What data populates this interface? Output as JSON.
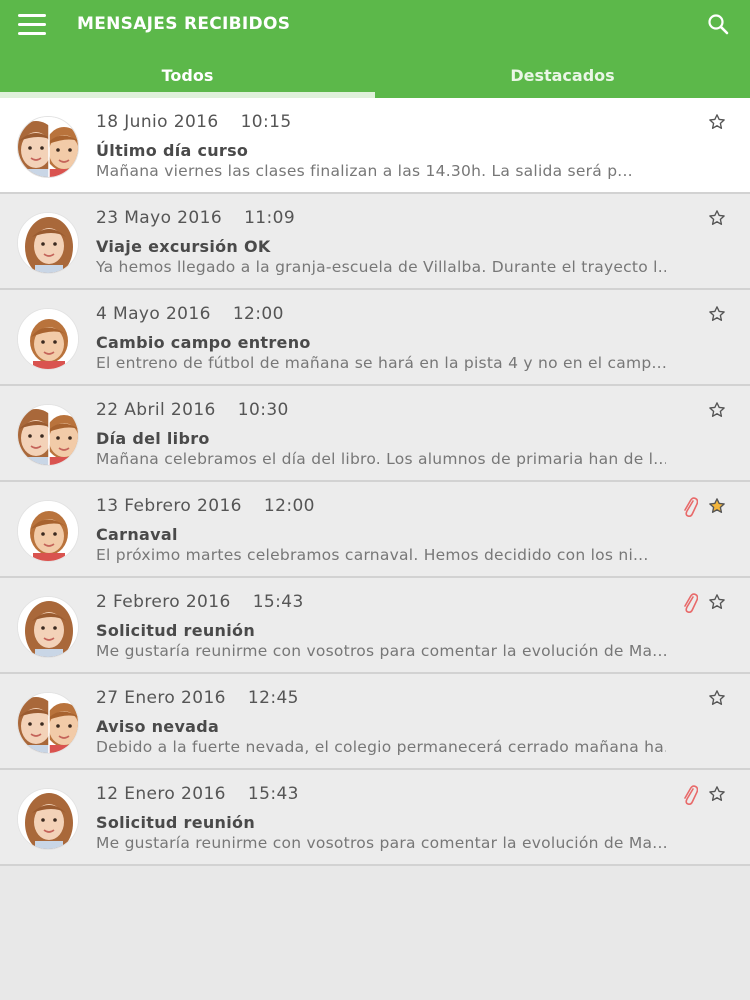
{
  "header": {
    "title": "MENSAJES RECIBIDOS",
    "menu_icon": "hamburger-menu-icon",
    "search_icon": "search-icon"
  },
  "tabs": [
    {
      "label": "Todos",
      "active": true
    },
    {
      "label": "Destacados",
      "active": false
    }
  ],
  "colors": {
    "primary": "#5cb84a",
    "star_active": "#f2b53c",
    "clip": "#e86a6a"
  },
  "messages": [
    {
      "date": "18 Junio 2016",
      "time": "10:15",
      "subject": "Último día curso",
      "preview": "Mañana viernes las clases finalizan a las 14.30h. La salida será p...",
      "avatar": "two-children",
      "attachment": false,
      "starred": false
    },
    {
      "date": "23 Mayo 2016",
      "time": "11:09",
      "subject": "Viaje excursión OK",
      "preview": "Ya hemos llegado a la granja-escuela de Villalba. Durante el trayecto l...",
      "avatar": "girl",
      "attachment": false,
      "starred": false
    },
    {
      "date": "4 Mayo 2016",
      "time": "12:00",
      "subject": "Cambio campo entreno",
      "preview": "El entreno de fútbol de mañana se hará en la pista 4 y no en el camp...",
      "avatar": "boy",
      "attachment": false,
      "starred": false
    },
    {
      "date": "22 Abril 2016",
      "time": "10:30",
      "subject": "Día del libro",
      "preview": "Mañana celebramos el día del libro. Los alumnos de primaria han de l...",
      "avatar": "two-children",
      "attachment": false,
      "starred": false
    },
    {
      "date": "13 Febrero 2016",
      "time": "12:00",
      "subject": "Carnaval",
      "preview": "El próximo martes celebramos carnaval. Hemos decidido con los ni...",
      "avatar": "boy",
      "attachment": true,
      "starred": true
    },
    {
      "date": "2 Febrero 2016",
      "time": "15:43",
      "subject": "Solicitud reunión",
      "preview": "Me gustaría reunirme con vosotros para comentar la evolución de Ma...",
      "avatar": "girl",
      "attachment": true,
      "starred": false
    },
    {
      "date": "27 Enero 2016",
      "time": "12:45",
      "subject": "Aviso nevada",
      "preview": "Debido a la fuerte nevada, el colegio permanecerá cerrado mañana ha...",
      "avatar": "two-children",
      "attachment": false,
      "starred": false
    },
    {
      "date": "12 Enero 2016",
      "time": "15:43",
      "subject": "Solicitud reunión",
      "preview": "Me gustaría reunirme con vosotros para comentar la evolución de Ma...",
      "avatar": "girl",
      "attachment": true,
      "starred": false
    }
  ]
}
